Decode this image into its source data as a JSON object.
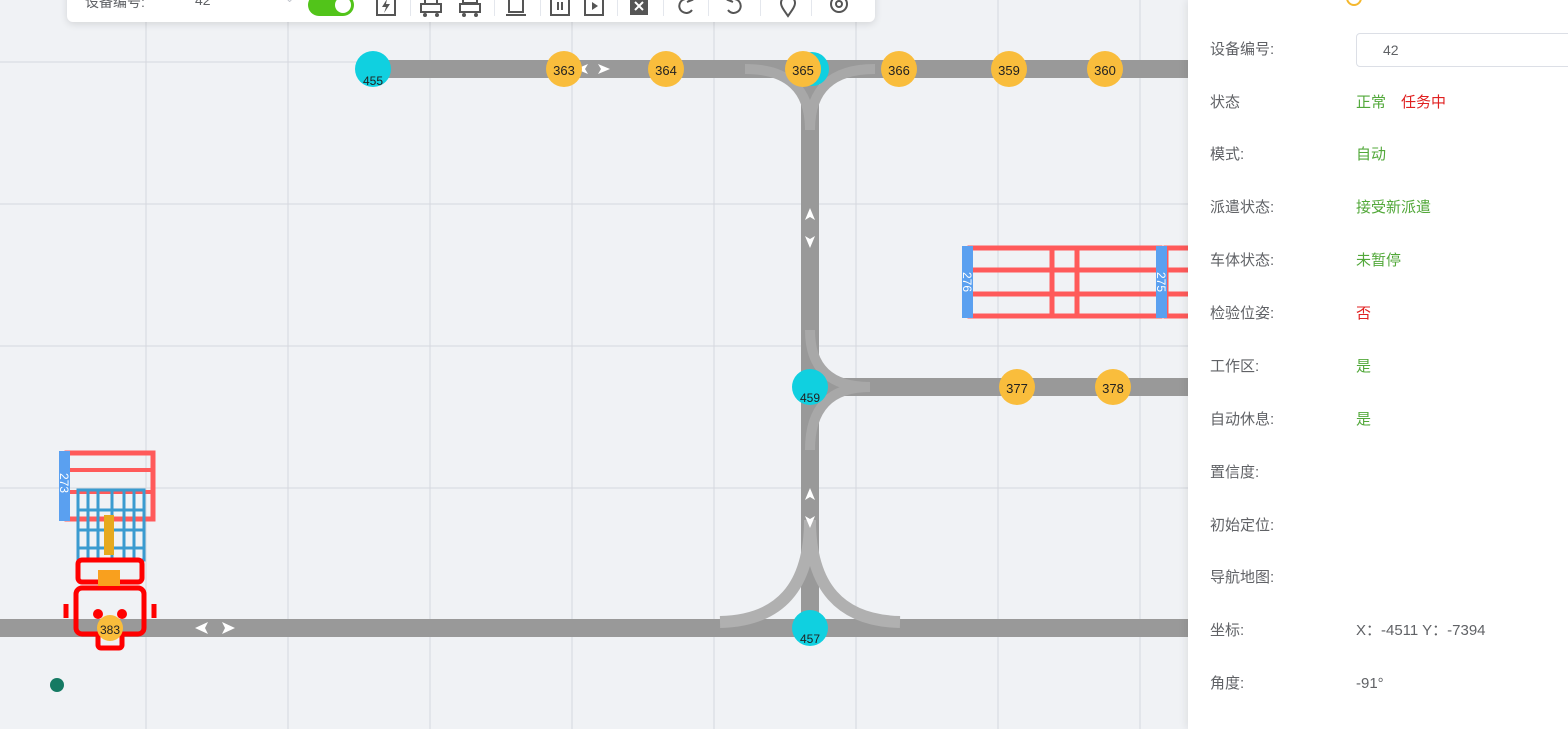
{
  "toolbar": {
    "device_label": "设备编号:",
    "device_value": "42",
    "icons": [
      "charge-icon",
      "agv-icon",
      "agv-load-icon",
      "station-icon",
      "pause-icon",
      "play-icon",
      "delete-icon",
      "undo-icon",
      "redo-icon",
      "location-pin-icon",
      "target-icon"
    ]
  },
  "map": {
    "nodes": [
      {
        "id": "455",
        "type": "junction"
      },
      {
        "id": "363",
        "type": "point"
      },
      {
        "id": "364",
        "type": "point"
      },
      {
        "id": "365",
        "type": "point"
      },
      {
        "id": "366",
        "type": "point"
      },
      {
        "id": "359",
        "type": "point"
      },
      {
        "id": "360",
        "type": "point"
      },
      {
        "id": "459",
        "type": "junction"
      },
      {
        "id": "377",
        "type": "point"
      },
      {
        "id": "378",
        "type": "point"
      },
      {
        "id": "457",
        "type": "junction"
      },
      {
        "id": "383",
        "type": "point"
      }
    ],
    "shelves": [
      {
        "id": "276"
      },
      {
        "id": "275"
      },
      {
        "id": "273"
      }
    ],
    "colors": {
      "road": "#999999",
      "junction": "#10d0e0",
      "point": "#f9bd3c",
      "shelf": "#ff5a5a",
      "shelf_tag": "#5aa0f0",
      "agv": "#ff0000",
      "rack": "#3a9bd0"
    }
  },
  "panel": {
    "device_label": "设备编号:",
    "device_value": "42",
    "status_label": "状态",
    "status_normal": "正常",
    "status_task": "任务中",
    "mode_label": "模式:",
    "mode_value": "自动",
    "dispatch_label": "派遣状态:",
    "dispatch_value": "接受新派遣",
    "body_label": "车体状态:",
    "body_value": "未暂停",
    "pose_label": "检验位姿:",
    "pose_value": "否",
    "workzone_label": "工作区:",
    "workzone_value": "是",
    "autorest_label": "自动休息:",
    "autorest_value": "是",
    "confidence_label": "置信度:",
    "initpos_label": "初始定位:",
    "navmap_label": "导航地图:",
    "coord_label": "坐标:",
    "coord_value": "X：-4511 Y：-7394",
    "angle_label": "角度:",
    "angle_value": "-91°"
  }
}
